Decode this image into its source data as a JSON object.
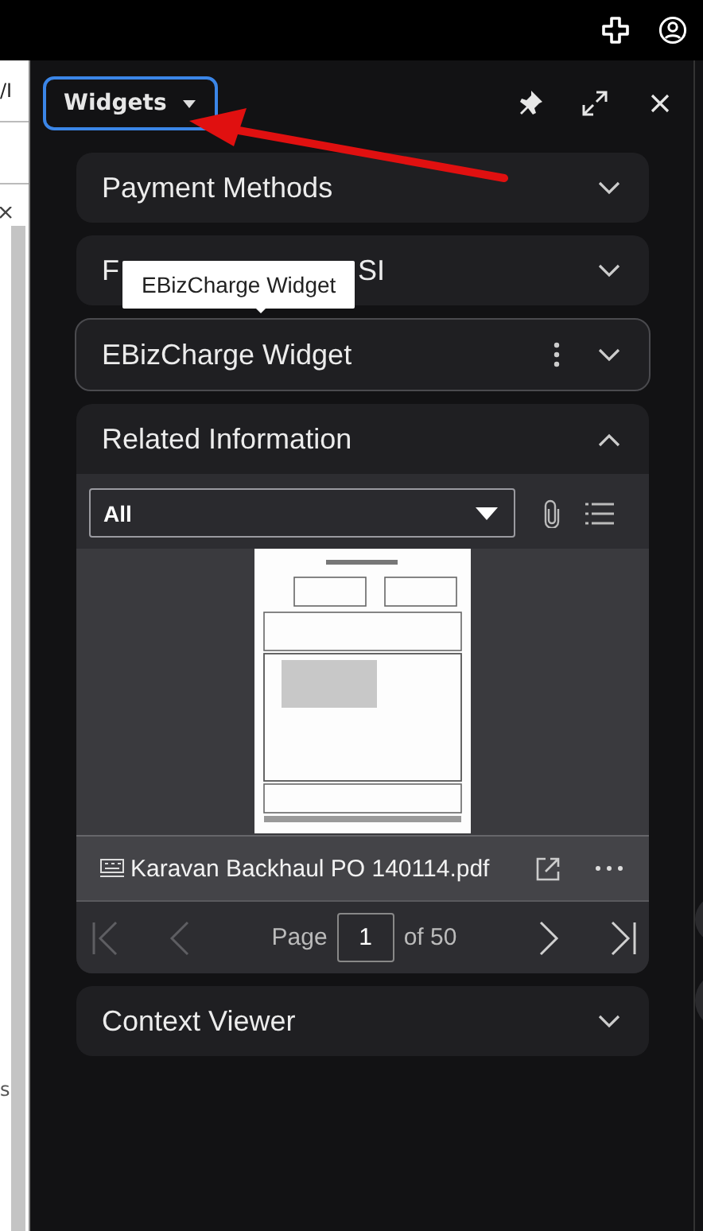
{
  "background_app": {
    "texts": [
      "/I",
      "s"
    ]
  },
  "panel": {
    "menu_button": {
      "label": "Widgets"
    }
  },
  "widgets": [
    {
      "kind": "plain",
      "title_parts": [
        "Payment Methods"
      ],
      "expanded": false,
      "hovered": false,
      "has_menu": false
    },
    {
      "kind": "plain",
      "title_parts": [
        "F",
        "SI"
      ],
      "expanded": false,
      "hovered": false,
      "has_menu": false
    },
    {
      "kind": "plain",
      "title_parts": [
        "EBizCharge Widget"
      ],
      "expanded": false,
      "hovered": true,
      "has_menu": true
    },
    {
      "kind": "related",
      "title_parts": [
        "Related Information"
      ],
      "expanded": true,
      "hovered": false,
      "has_menu": false
    },
    {
      "kind": "plain",
      "title_parts": [
        "Context Viewer"
      ],
      "expanded": false,
      "hovered": false,
      "has_menu": false
    }
  ],
  "tooltip": {
    "text": "EBizCharge Widget"
  },
  "related": {
    "filter": {
      "value": "All"
    },
    "document": {
      "kind": "picture",
      "file_name": "Karavan Backhaul PO 140114.pdf"
    },
    "pager": {
      "label": "Page",
      "page": "1",
      "of": "of",
      "total": "50",
      "buttons": [
        {
          "kind": "first",
          "disabled": true
        },
        {
          "kind": "prev",
          "disabled": true
        },
        {
          "kind": "next",
          "disabled": false
        },
        {
          "kind": "last",
          "disabled": false
        }
      ]
    }
  }
}
